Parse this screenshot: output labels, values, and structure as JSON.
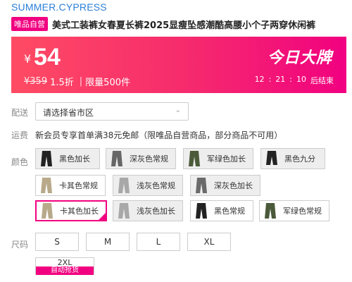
{
  "brand": "SUMMER.CYPRESS",
  "tag": "唯品自营",
  "title": "美式工装裤女春夏长裤2025显瘦坠感潮酷高腰小个子两穿休闲裤",
  "banner": {
    "currency": "¥",
    "price": "54",
    "original_price": "¥359",
    "discount": "1.5折",
    "separator": "|",
    "limit": "限量500件",
    "logo": "今日大牌",
    "countdown": {
      "h": "12",
      "m": "21",
      "s": "10",
      "sep": ":",
      "suffix": "后结束"
    }
  },
  "delivery": {
    "label": "配送",
    "placeholder": "请选择省市区",
    "chevron": "⌄"
  },
  "shipping": {
    "label": "运费",
    "text": "新会员专享首单满38元免邮（限唯品自营商品，部分商品不可用）"
  },
  "color": {
    "label": "颜色",
    "options": [
      {
        "label": "黑色加长",
        "swatch": "#222222"
      },
      {
        "label": "深灰色常规",
        "swatch": "#666666"
      },
      {
        "label": "军绿色加长",
        "swatch": "#4b5a3a"
      },
      {
        "label": "黑色九分",
        "swatch": "#222222"
      },
      {
        "label": "卡其色常规",
        "swatch": "#b8a98a"
      },
      {
        "label": "浅灰色常规",
        "swatch": "#a8a8a8"
      },
      {
        "label": "深灰色加长",
        "swatch": "#6a6a6a"
      },
      {
        "label": "卡其色加长",
        "swatch": "#b8a98a"
      },
      {
        "label": "浅灰色加长",
        "swatch": "#a8a8a8"
      },
      {
        "label": "黑色常规",
        "swatch": "#222222"
      },
      {
        "label": "军绿色常规",
        "swatch": "#4b5a3a"
      }
    ],
    "selected": "卡其色加长",
    "check_icon": "✓"
  },
  "size": {
    "label": "尺码",
    "options": [
      "S",
      "M",
      "L",
      "XL"
    ],
    "extra": {
      "label": "2XL",
      "badge": "自动抢货"
    }
  },
  "colors": {
    "accent": "#f10180",
    "brand_link": "#2b7fd8"
  }
}
